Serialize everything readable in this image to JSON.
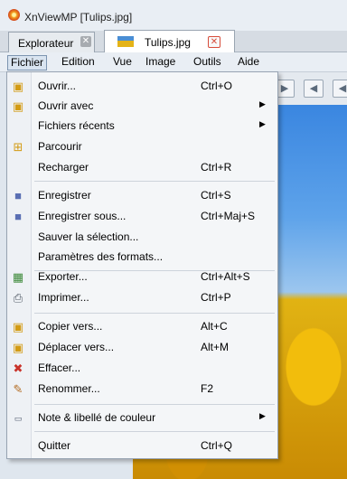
{
  "window": {
    "title": "XnViewMP [Tulips.jpg]"
  },
  "tabs": [
    {
      "label": "Explorateur",
      "close": "✕"
    },
    {
      "label": "Tulips.jpg",
      "close": "✕"
    }
  ],
  "menubar": [
    "Fichier",
    "Edition",
    "Vue",
    "Image",
    "Outils",
    "Aide"
  ],
  "file_menu": [
    {
      "label": "Ouvrir...",
      "shortcut": "Ctrl+O",
      "icon": "open-folder-icon",
      "submenu": false
    },
    {
      "label": "Ouvrir avec",
      "shortcut": "",
      "icon": "open-with-icon",
      "submenu": true
    },
    {
      "label": "Fichiers récents",
      "shortcut": "",
      "icon": "",
      "submenu": true
    },
    {
      "label": "Parcourir",
      "shortcut": "",
      "icon": "browse-icon",
      "submenu": false
    },
    {
      "label": "Recharger",
      "shortcut": "Ctrl+R",
      "icon": "",
      "submenu": false
    },
    {
      "label": "Enregistrer",
      "shortcut": "Ctrl+S",
      "icon": "save-icon",
      "submenu": false
    },
    {
      "label": "Enregistrer sous...",
      "shortcut": "Ctrl+Maj+S",
      "icon": "save-as-icon",
      "submenu": false
    },
    {
      "label": "Sauver la sélection...",
      "shortcut": "",
      "icon": "",
      "submenu": false
    },
    {
      "label": "Paramètres des formats...",
      "shortcut": "",
      "icon": "",
      "submenu": false
    },
    {
      "label": "Exporter...",
      "shortcut": "Ctrl+Alt+S",
      "icon": "export-icon",
      "submenu": false
    },
    {
      "label": "Imprimer...",
      "shortcut": "Ctrl+P",
      "icon": "print-icon",
      "submenu": false
    },
    {
      "label": "Copier vers...",
      "shortcut": "Alt+C",
      "icon": "copy-to-icon",
      "submenu": false
    },
    {
      "label": "Déplacer vers...",
      "shortcut": "Alt+M",
      "icon": "move-to-icon",
      "submenu": false
    },
    {
      "label": "Effacer...",
      "shortcut": "",
      "icon": "delete-icon",
      "submenu": false
    },
    {
      "label": "Renommer...",
      "shortcut": "F2",
      "icon": "rename-icon",
      "submenu": false
    },
    {
      "label": "Note & libellé de couleur",
      "shortcut": "",
      "icon": "rating-icon",
      "submenu": true
    },
    {
      "label": "Quitter",
      "shortcut": "Ctrl+Q",
      "icon": "",
      "submenu": false
    }
  ]
}
